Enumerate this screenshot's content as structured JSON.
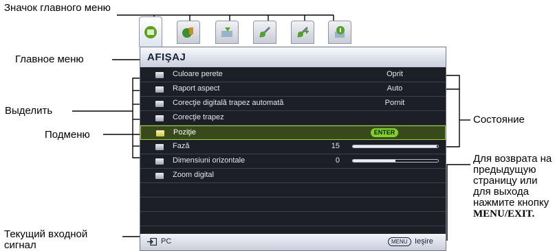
{
  "annotations": {
    "main_menu_icon": "Значок главного меню",
    "main_menu": "Главное меню",
    "highlight": "Выделить",
    "submenu": "Подменю",
    "current_input": "Текущий входной сигнал",
    "status": "Состояние",
    "back_exit_line1": "Для возврата на предыдущую страницу или для выхода нажмите кнопку",
    "back_exit_key": "MENU/EXIT."
  },
  "tabs": [
    {
      "icon": "display-icon",
      "active": true
    },
    {
      "icon": "picture-icon",
      "active": false
    },
    {
      "icon": "source-icon",
      "active": false
    },
    {
      "icon": "system-setup-basic-icon",
      "active": false
    },
    {
      "icon": "system-setup-advanced-icon",
      "active": false
    },
    {
      "icon": "information-icon",
      "active": false
    }
  ],
  "menu": {
    "title": "AFIŞAJ",
    "rows": [
      {
        "label": "Culoare perete",
        "value": "Oprit",
        "icon": "wall-color-icon"
      },
      {
        "label": "Raport aspect",
        "value": "Auto",
        "icon": "aspect-ratio-icon"
      },
      {
        "label": "Corecţie digitală trapez automată",
        "value": "Pornit",
        "icon": "auto-keystone-icon"
      },
      {
        "label": "Corecţie trapez",
        "value": "",
        "icon": "keystone-icon"
      },
      {
        "label": "Poziţie",
        "button": "ENTER",
        "icon": "position-icon",
        "selected": true
      },
      {
        "label": "Fază",
        "num": "15",
        "level": 0.98,
        "icon": "phase-icon"
      },
      {
        "label": "Dimensiuni orizontale",
        "num": "0",
        "level": 0.5,
        "icon": "h-size-icon"
      },
      {
        "label": "Zoom digital",
        "value": "",
        "icon": "digital-zoom-icon"
      }
    ]
  },
  "footer": {
    "input": "PC",
    "menu_key": "MENU",
    "exit": "Ieşire"
  }
}
